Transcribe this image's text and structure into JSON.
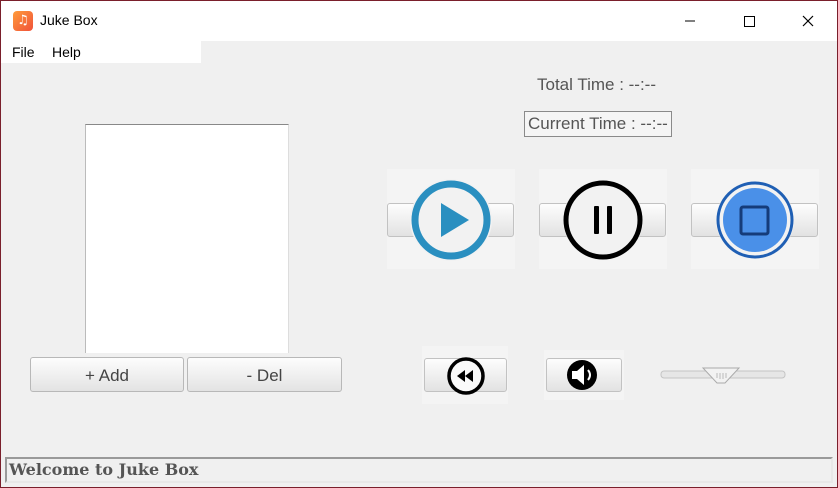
{
  "window": {
    "title": "Juke Box",
    "app_icon": "music-note-icon",
    "controls": [
      "minimize-icon",
      "maximize-icon",
      "close-icon"
    ]
  },
  "menu": {
    "file": "File",
    "help": "Help"
  },
  "playlist": {
    "items": [],
    "add_label": "+ Add",
    "del_label": "- Del"
  },
  "timing": {
    "total": "Total Time : --:--",
    "current": "Current Time : --:--"
  },
  "controls": {
    "play_icon": "play-icon",
    "pause_icon": "pause-icon",
    "stop_icon": "stop-icon",
    "rewind_icon": "rewind-icon",
    "volume_icon": "speaker-icon"
  },
  "colors": {
    "play_accent": "#2a8fc0",
    "stop_accent": "#4a90e8",
    "window_border": "#7a1f2b"
  },
  "status": {
    "text": "Welcome to Juke Box"
  }
}
